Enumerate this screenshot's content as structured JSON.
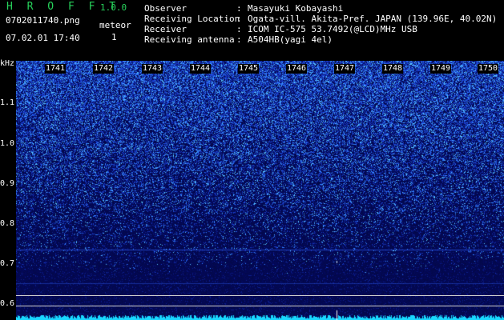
{
  "app": {
    "name": "H R O F F T",
    "version": "1.0.0",
    "filename": "0702011740.png",
    "datetime": "07.02.01 17:40",
    "meteor_label": "meteor",
    "meteor_count": "1"
  },
  "info": [
    {
      "key": "Observer",
      "value": "Masayuki Kobayashi"
    },
    {
      "key": "Receiving Location",
      "value": "Ogata-vill. Akita-Pref. JAPAN (139.96E, 40.02N)"
    },
    {
      "key": "Receiver",
      "value": "ICOM IC-575 53.7492(@LCD)MHz USB"
    },
    {
      "key": "Receiving antenna",
      "value": "A504HB(yagi 4el)"
    }
  ],
  "spectrogram": {
    "y_unit": "kHz",
    "y_ticks": [
      "1.1",
      "1.0",
      "0.9",
      "0.8",
      "0.7",
      "0.6"
    ],
    "time_ticks": [
      "1741",
      "1742",
      "1743",
      "1744",
      "1745",
      "1746",
      "1747",
      "1748",
      "1749",
      "1750"
    ],
    "colors": {
      "background": "#000000",
      "plot_bg": "#030a55",
      "noise_high": "#3e8cff",
      "noise_low": "#1c2db6",
      "title_green": "#27d25b",
      "trace": "#19d7ff"
    }
  }
}
